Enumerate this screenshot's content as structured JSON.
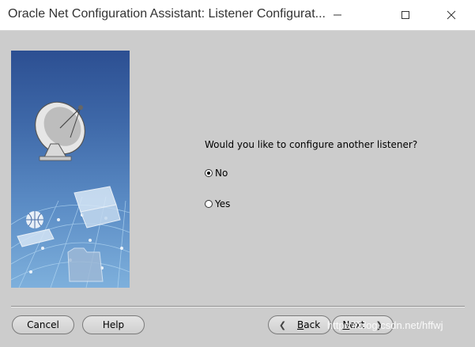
{
  "window": {
    "title": "Oracle Net Configuration Assistant: Listener Configurat..."
  },
  "main": {
    "question": "Would you like to configure another listener?",
    "options": [
      {
        "label": "No",
        "selected": true
      },
      {
        "label": "Yes",
        "selected": false
      }
    ]
  },
  "buttons": {
    "cancel": "Cancel",
    "help": "Help",
    "back_mnemonic": "B",
    "back_rest": "ack",
    "next_mnemonic": "N",
    "next_rest": "ext"
  },
  "watermark": "https://blog.csdn.net/hffwj",
  "icons": {
    "minimize": "minimize-icon",
    "maximize": "maximize-icon",
    "close": "close-icon",
    "back": "chevron-left-icon",
    "next": "chevron-right-icon"
  },
  "colors": {
    "background": "#cccccc",
    "titlebar": "#ffffff",
    "art_top": "#2c4f92",
    "art_bottom": "#7eb0dc"
  }
}
